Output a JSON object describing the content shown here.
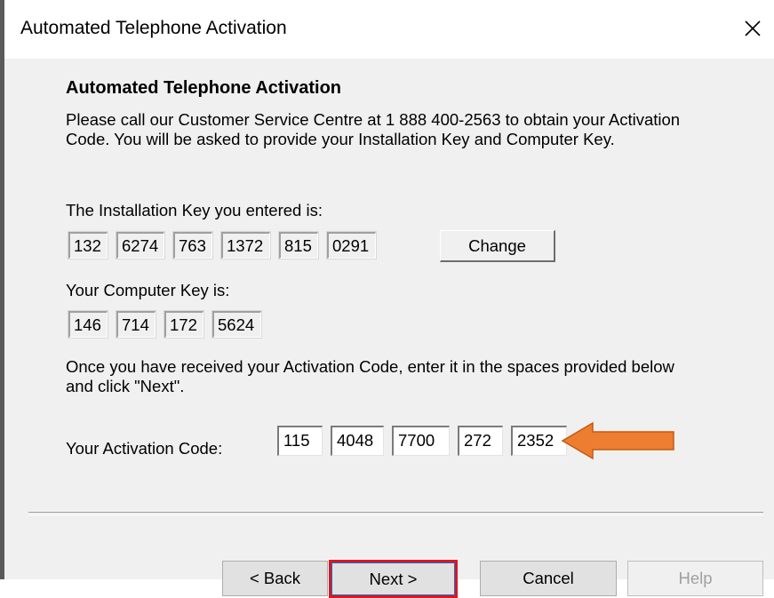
{
  "window": {
    "title": "Automated Telephone Activation"
  },
  "content": {
    "heading": "Automated Telephone Activation",
    "intro": "Please call our Customer Service Centre at 1 888 400-2563 to obtain your Activation Code.  You will be asked to provide your Installation Key and Computer Key.",
    "installation_key_label": "The Installation Key you entered is:",
    "installation_key": [
      "132",
      "6274",
      "763",
      "1372",
      "815",
      "0291"
    ],
    "change_label": "Change",
    "computer_key_label": "Your Computer Key is:",
    "computer_key": [
      "146",
      "714",
      "172",
      "5624"
    ],
    "instruction": "Once you have received your Activation Code, enter it in the spaces provided below and click \"Next\".",
    "activation_code_label": "Your Activation Code:",
    "activation_code": [
      "115",
      "4048",
      "7700",
      "272",
      "2352"
    ]
  },
  "buttons": {
    "back": "< Back",
    "next": "Next >",
    "cancel": "Cancel",
    "help": "Help"
  },
  "colors": {
    "arrow": "#ed7d31",
    "highlight": "#e0141e"
  },
  "icons": {
    "close": "close-icon",
    "annotation": "orange-arrow-icon"
  }
}
